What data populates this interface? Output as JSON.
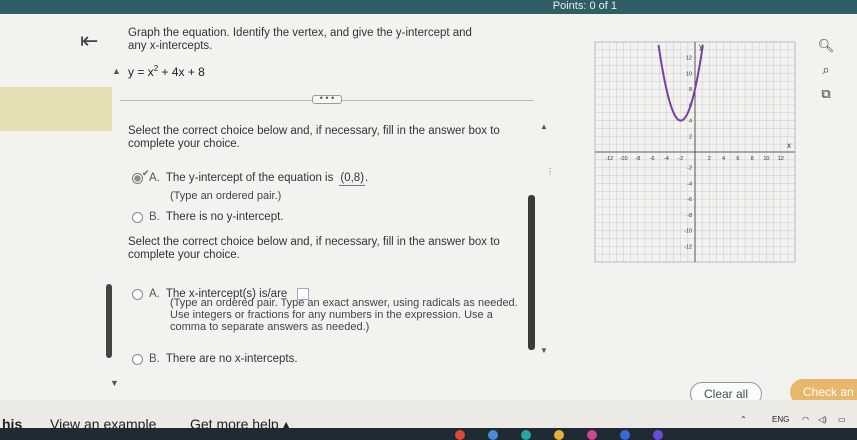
{
  "header": {
    "points_text": "Points: 0 of 1"
  },
  "question": {
    "prompt": "Graph the equation. Identify the vertex, and give the y-intercept and any x-intercepts.",
    "equation_lhs": "y = x",
    "equation_exp": "2",
    "equation_rest": " + 4x + 8"
  },
  "divider_label": "• • •",
  "part1": {
    "instruction": "Select the correct choice below and, if necessary, fill in the answer box to complete your choice.",
    "choice_a_letter": "A.",
    "choice_a_text": "The y-intercept of the equation is",
    "choice_a_value": "(0,8)",
    "choice_a_period": ".",
    "choice_a_hint": "(Type an ordered pair.)",
    "choice_b_letter": "B.",
    "choice_b_text": "There is no y-intercept."
  },
  "part2": {
    "instruction": "Select the correct choice below and, if necessary, fill in the answer box to complete your choice.",
    "choice_a_letter": "A.",
    "choice_a_text": "The x-intercept(s) is/are",
    "choice_a_hint1": "(Type an ordered pair. Type an exact answer, using radicals as needed.",
    "choice_a_hint2": "Use integers or fractions for any numbers in the expression. Use a",
    "choice_a_hint3": "comma to separate answers as needed.)",
    "choice_b_letter": "B.",
    "choice_b_text": "There are no x-intercepts."
  },
  "graph": {
    "x_label": "x",
    "y_label": "y",
    "x_ticks": [
      "-12",
      "-10",
      "-8",
      "-6",
      "-4",
      "-2",
      "2",
      "4",
      "6",
      "8",
      "10",
      "12"
    ],
    "y_ticks": [
      "12",
      "10",
      "8",
      "6",
      "4",
      "2",
      "-2",
      "-4",
      "-6",
      "-8",
      "-10",
      "-12"
    ],
    "curve_color": "#7a3fa0"
  },
  "tools": {
    "zoom_in_icon": "zoom-in-icon",
    "zoom_out_icon": "zoom-out-icon",
    "popout_icon": "external-link-icon"
  },
  "buttons": {
    "clear_all": "Clear all",
    "check_answer": "Check an"
  },
  "footer": {
    "help_partial": "his",
    "view_example": "View an example",
    "get_more_help": "Get more help ▴"
  },
  "tray": {
    "lang": "ENG"
  },
  "colors": {
    "accent": "#e7b76a",
    "topbar": "#2f5f64",
    "highlight": "#e6dfb4"
  }
}
